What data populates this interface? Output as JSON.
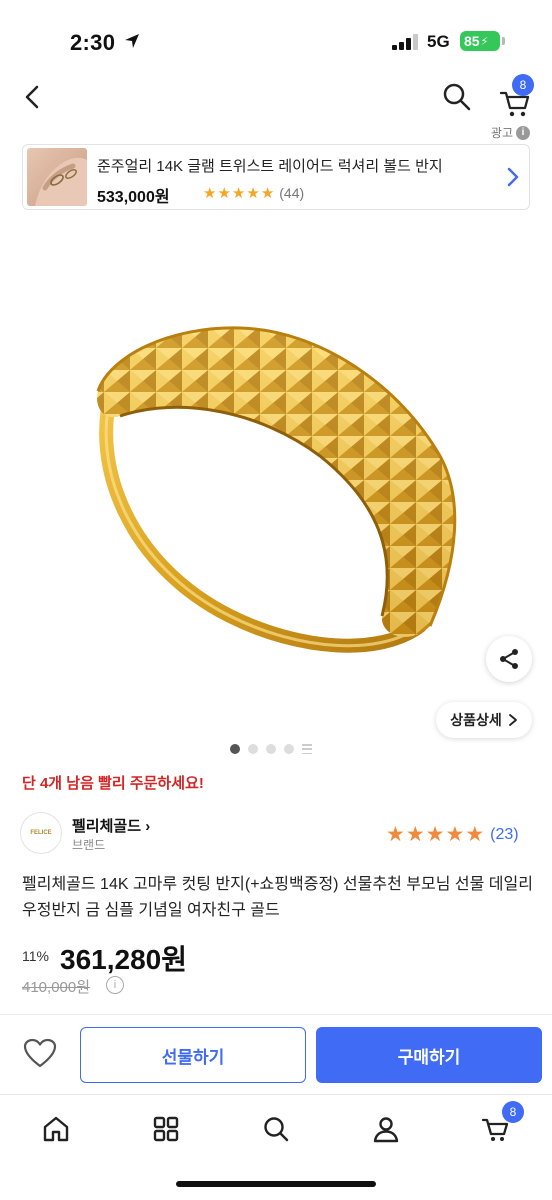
{
  "status_bar": {
    "time": "2:30",
    "network": "5G",
    "battery": "85"
  },
  "header": {
    "cart_count": "8"
  },
  "ad": {
    "label": "광고",
    "title": "준주얼리 14K 글램 트위스트 레이어드 럭셔리 볼드 반지",
    "price": "533,000원",
    "rating": 5,
    "review_count": "(44)"
  },
  "product": {
    "detail_button": "상품상세",
    "image_count": 4,
    "active_image": 1,
    "urgency": "단 4개 남음 빨리 주문하세요!",
    "brand": {
      "name": "펠리체골드",
      "sub": "브랜드",
      "logo_text": "FELICE"
    },
    "rating": 5,
    "review_count": "(23)",
    "title": "펠리체골드 14K 고마루 컷팅 반지(+쇼핑백증정) 선물추천 부모님 선물 데일리 우정반지 금 심플 기념일 여자친구 골드",
    "discount": "11%",
    "price": "361,280원",
    "original_price": "410,000원"
  },
  "actions": {
    "gift": "선물하기",
    "buy": "구매하기"
  },
  "tab_bar": {
    "items": [
      "home-icon",
      "grid-icon",
      "search-icon",
      "user-icon",
      "cart-icon"
    ],
    "cart_count": "8"
  },
  "colors": {
    "accent": "#3f6bf5",
    "urgent": "#d42626",
    "star": "#f5a623",
    "rating_star": "#f08a3c",
    "gold": "#d9a621"
  }
}
